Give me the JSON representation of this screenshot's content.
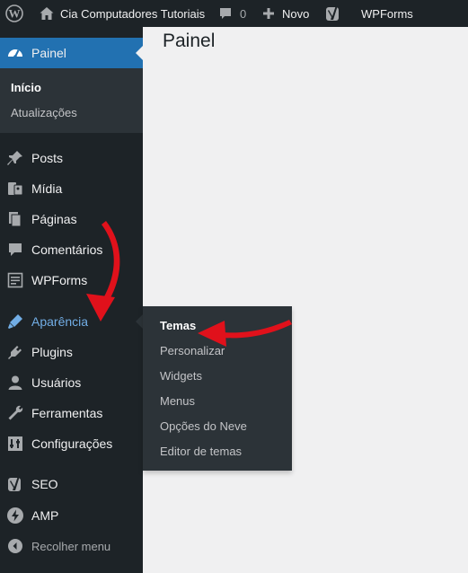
{
  "adminbar": {
    "site_name": "Cia Computadores Tutoriais",
    "comments_count": "0",
    "new_label": "Novo",
    "wpforms_label": "WPForms",
    "wp_logo_icon": "wordpress-icon",
    "home_icon": "home-icon",
    "comment_icon": "comment-icon",
    "plus_icon": "plus-icon",
    "yoast_icon": "yoast-icon"
  },
  "page": {
    "title": "Painel"
  },
  "sidebar": {
    "dashboard": {
      "label": "Painel",
      "icon": "dashboard-icon"
    },
    "dashboard_sub": [
      "Início",
      "Atualizações"
    ],
    "items": [
      {
        "label": "Posts",
        "icon": "pin-icon"
      },
      {
        "label": "Mídia",
        "icon": "media-icon"
      },
      {
        "label": "Páginas",
        "icon": "pages-icon"
      },
      {
        "label": "Comentários",
        "icon": "comments-icon"
      },
      {
        "label": "WPForms",
        "icon": "wpforms-icon"
      },
      {
        "label": "Aparência",
        "icon": "appearance-icon"
      },
      {
        "label": "Plugins",
        "icon": "plugins-icon"
      },
      {
        "label": "Usuários",
        "icon": "users-icon"
      },
      {
        "label": "Ferramentas",
        "icon": "tools-icon"
      },
      {
        "label": "Configurações",
        "icon": "settings-icon"
      },
      {
        "label": "SEO",
        "icon": "yoast-icon"
      },
      {
        "label": "AMP",
        "icon": "amp-icon"
      },
      {
        "label": "Recolher menu",
        "icon": "collapse-icon"
      }
    ]
  },
  "appearance_submenu": [
    "Temas",
    "Personalizar",
    "Widgets",
    "Menus",
    "Opções do Neve",
    "Editor de temas"
  ],
  "colors": {
    "bar": "#1d2327",
    "accent": "#2271b1",
    "hover_text": "#72aee6",
    "arrow": "#e0111b"
  }
}
